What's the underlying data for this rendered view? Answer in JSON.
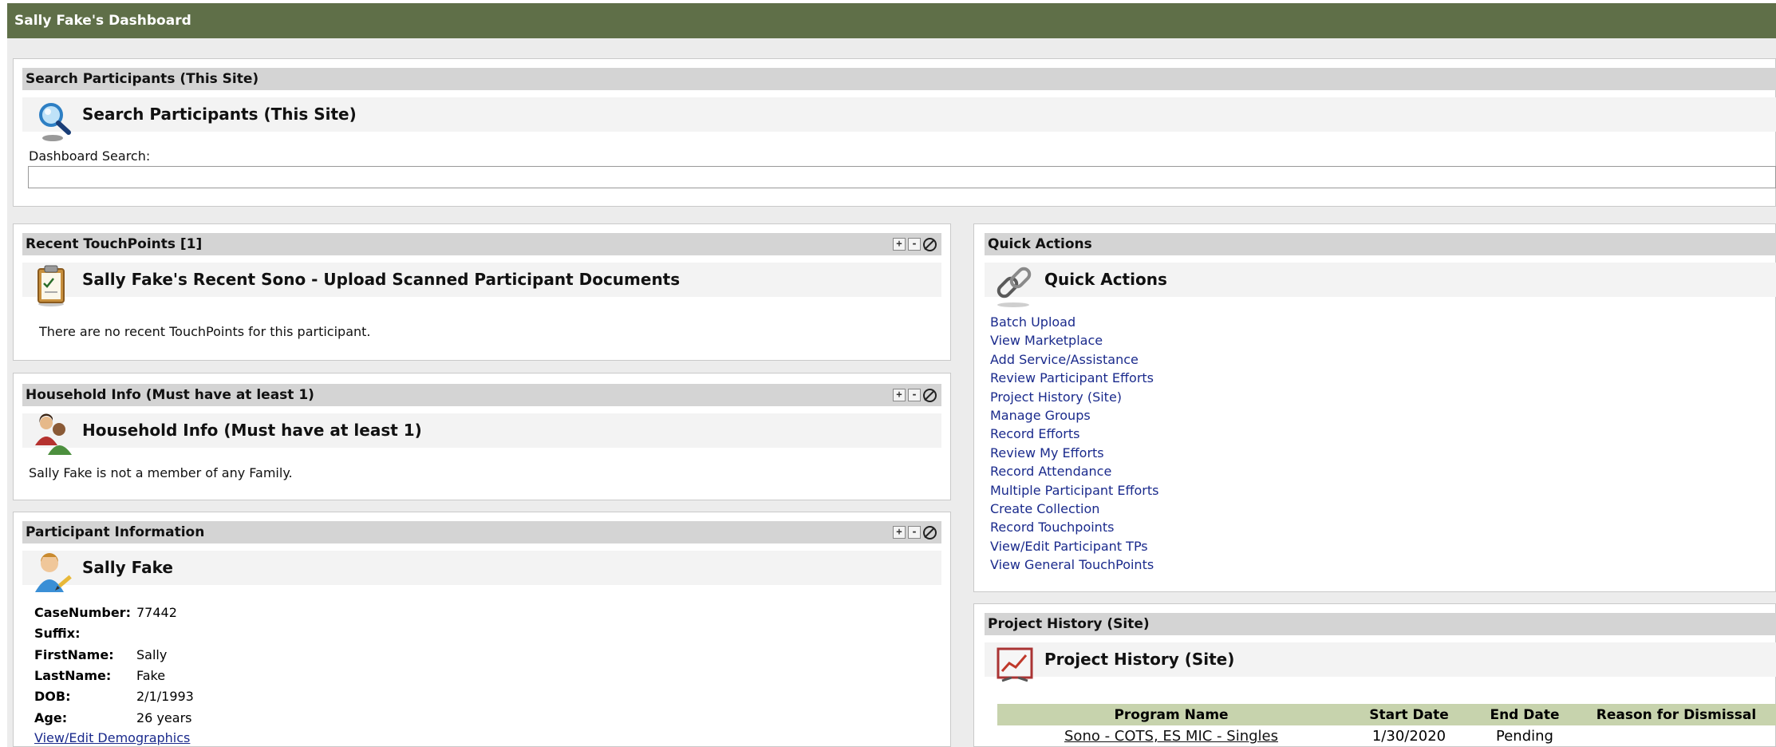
{
  "window": {
    "title": "Sally Fake's Dashboard"
  },
  "search_panel": {
    "header": "Search Participants (This Site)",
    "title": "Search Participants (This Site)",
    "field_label": "Dashboard Search:",
    "field_value": ""
  },
  "touchpoints_panel": {
    "header": "Recent TouchPoints [1]",
    "title": "Sally Fake's Recent Sono - Upload Scanned Participant Documents",
    "message": "There are no recent TouchPoints for this participant."
  },
  "household_panel": {
    "header": "Household Info (Must have at least 1)",
    "title": "Household Info (Must have at least 1)",
    "message": "Sally Fake is not a member of any Family."
  },
  "participant_panel": {
    "header": "Participant Information",
    "title": "Sally Fake",
    "fields": [
      {
        "label": "CaseNumber:",
        "value": "77442"
      },
      {
        "label": "Suffix:",
        "value": ""
      },
      {
        "label": "FirstName:",
        "value": "Sally"
      },
      {
        "label": "LastName:",
        "value": "Fake"
      },
      {
        "label": "DOB:",
        "value": "2/1/1993"
      },
      {
        "label": "Age:",
        "value": "26 years"
      }
    ],
    "edit_link": "View/Edit Demographics"
  },
  "quick_actions": {
    "header": "Quick Actions",
    "title": "Quick Actions",
    "links": [
      "Batch Upload",
      "View Marketplace",
      "Add Service/Assistance",
      "Review Participant Efforts",
      "Project History (Site)",
      "Manage Groups",
      "Record Efforts",
      "Review My Efforts",
      "Record Attendance",
      "Multiple Participant Efforts",
      "Create Collection",
      "Record Touchpoints",
      "View/Edit Participant TPs",
      "View General TouchPoints"
    ]
  },
  "project_history": {
    "header": "Project History (Site)",
    "title": "Project History (Site)",
    "columns": [
      "Program Name",
      "Start Date",
      "End Date",
      "Reason for Dismissal"
    ],
    "rows": [
      {
        "program": "Sono - COTS, ES MIC - Singles",
        "start": "1/30/2020",
        "end": "Pending",
        "reason": ""
      }
    ]
  },
  "panel_controls": {
    "expand": "+",
    "collapse": "-"
  },
  "colors": {
    "titlebar": "#5f6f48",
    "link": "#1a2a8c",
    "table_header": "#c7d3ad"
  }
}
